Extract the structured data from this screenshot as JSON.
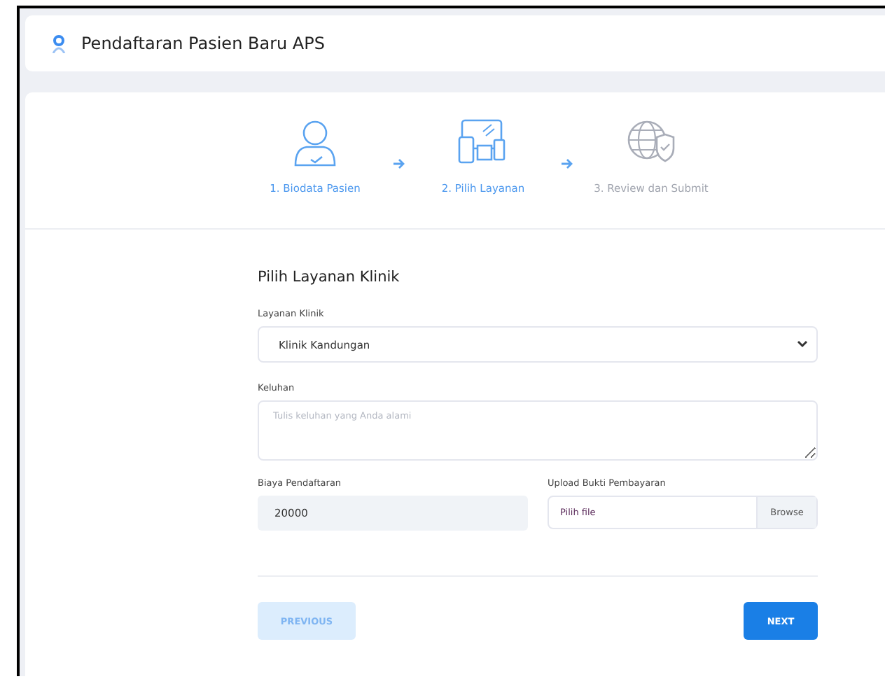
{
  "header": {
    "title": "Pendaftaran Pasien Baru APS"
  },
  "steps": [
    {
      "label": "1. Biodata Pasien",
      "kind": "person",
      "reached": true
    },
    {
      "label": "2. Pilih Layanan",
      "kind": "devices",
      "reached": true
    },
    {
      "label": "3. Review dan Submit",
      "kind": "globe",
      "reached": false
    }
  ],
  "form": {
    "title": "Pilih Layanan Klinik",
    "clinic": {
      "label": "Layanan Klinik",
      "value": "Klinik Kandungan"
    },
    "complaint": {
      "label": "Keluhan",
      "placeholder": "Tulis keluhan yang Anda alami"
    },
    "fee": {
      "label": "Biaya Pendaftaran",
      "value": "20000"
    },
    "upload": {
      "label": "Upload Bukti Pembayaran",
      "value": "Pilih file",
      "button": "Browse"
    }
  },
  "buttons": {
    "previous": {
      "label": "PREVIOUS",
      "disabled": true
    },
    "next": {
      "label": "NEXT",
      "disabled": false
    }
  }
}
